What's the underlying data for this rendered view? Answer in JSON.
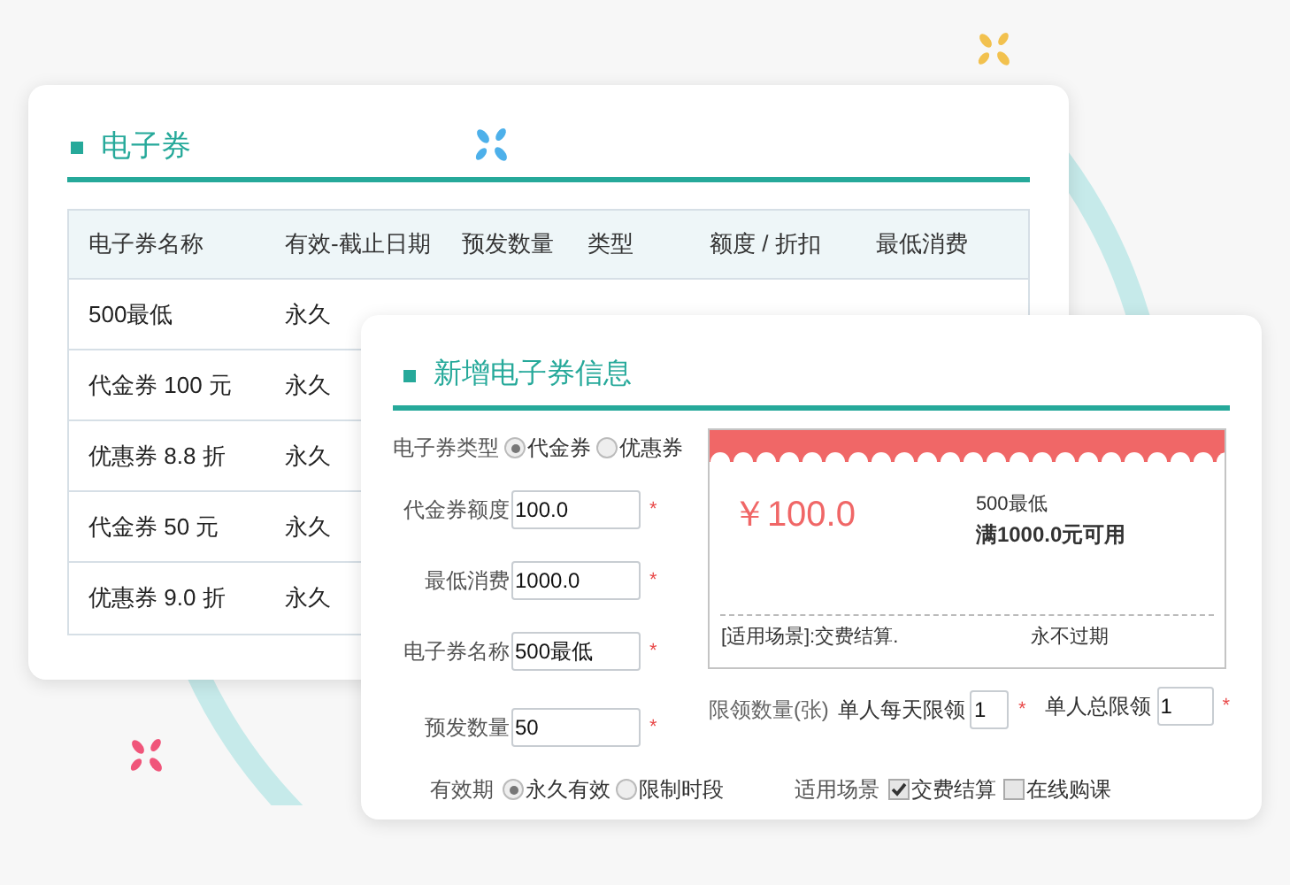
{
  "coupon_list": {
    "title": "电子券",
    "columns": [
      "电子券名称",
      "有效-截止日期",
      "预发数量",
      "类型",
      "额度 / 折扣",
      "最低消费"
    ],
    "rows": [
      [
        "500最低",
        "永久"
      ],
      [
        "代金券 100 元",
        "永久"
      ],
      [
        "优惠券 8.8 折",
        "永久"
      ],
      [
        "代金券 50 元",
        "永久"
      ],
      [
        "优惠券 9.0 折",
        "永久"
      ]
    ]
  },
  "new_coupon": {
    "title": "新增电子券信息",
    "type_field": {
      "label": "电子券类型",
      "options": [
        {
          "label": "代金券",
          "selected": true
        },
        {
          "label": "优惠券",
          "selected": false
        }
      ]
    },
    "fields": [
      {
        "label": "代金券额度",
        "value": "100.0",
        "mark": "*"
      },
      {
        "label": "最低消费",
        "value": "1000.0",
        "mark": "*"
      },
      {
        "label": "电子券名称",
        "value": "500最低",
        "mark": "*"
      },
      {
        "label": "预发数量",
        "value": "50",
        "mark": "*"
      }
    ],
    "preview": {
      "amount": "￥100.0",
      "name": "500最低",
      "condition": "满1000.0元可用",
      "scene": "[适用场景]:交费结算.",
      "expiry": "永不过期"
    },
    "limits": {
      "label": "限领数量(张)",
      "fields": [
        {
          "label": "单人每天限领",
          "value": "1",
          "mark": "*"
        },
        {
          "label": "单人总限领",
          "value": "1",
          "mark": "*"
        }
      ]
    },
    "validity": {
      "label": "有效期",
      "options": [
        {
          "label": "永久有效",
          "selected": true
        },
        {
          "label": "限制时段",
          "selected": false
        }
      ]
    },
    "scenes": {
      "label": "适用场景",
      "options": [
        {
          "label": "交费结算",
          "checked": true
        },
        {
          "label": "在线购课",
          "checked": false
        }
      ]
    }
  }
}
